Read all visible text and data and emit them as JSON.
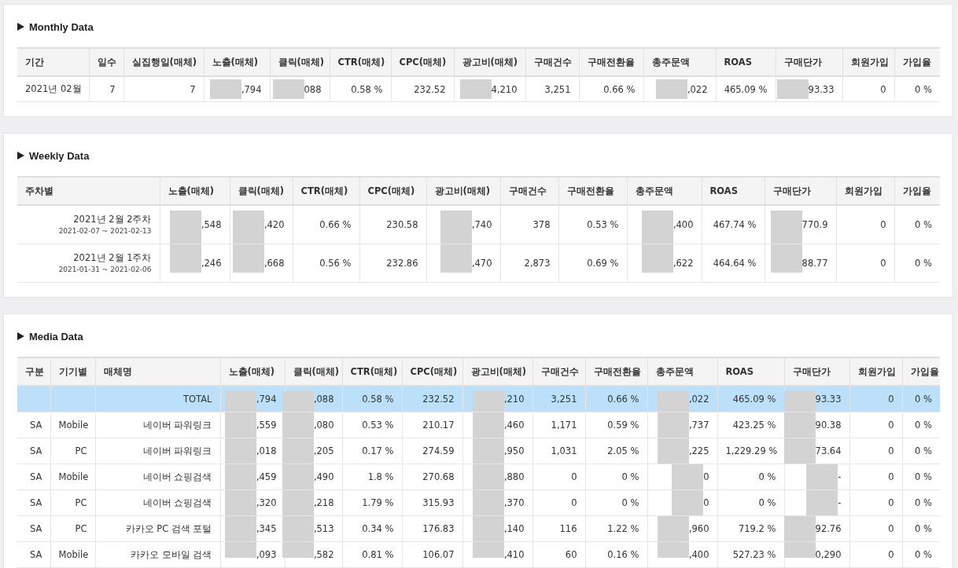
{
  "sections": [
    {
      "kind": "monthly",
      "title": "Monthly Data",
      "columns": [
        {
          "label": "기간",
          "redacted": false
        },
        {
          "label": "일수",
          "redacted": false
        },
        {
          "label": "실집행일(매체)",
          "redacted": false
        },
        {
          "label": "노출(매체)",
          "redacted": true
        },
        {
          "label": "클릭(매체)",
          "redacted": true
        },
        {
          "label": "CTR(매체)",
          "redacted": false
        },
        {
          "label": "CPC(매체)",
          "redacted": false
        },
        {
          "label": "광고비(매체)",
          "redacted": true
        },
        {
          "label": "구매건수",
          "redacted": false
        },
        {
          "label": "구매전환율",
          "redacted": false
        },
        {
          "label": "총주문액",
          "redacted": true
        },
        {
          "label": "ROAS",
          "redacted": false
        },
        {
          "label": "구매단가",
          "redacted": true
        },
        {
          "label": "회원가입",
          "redacted": false
        },
        {
          "label": "가입율",
          "redacted": false
        }
      ],
      "rows": [
        {
          "cells": [
            "2021년 02월",
            "7",
            "7",
            ",794",
            "088",
            "0.58 %",
            "232.52",
            "4,210",
            "3,251",
            "0.66 %",
            ",022",
            "465.09 %",
            "93.33",
            "0",
            "0 %"
          ]
        }
      ]
    },
    {
      "kind": "weekly",
      "title": "Weekly Data",
      "columns": [
        {
          "label": "주차별",
          "redacted": false
        },
        {
          "label": "노출(매체)",
          "redacted": true
        },
        {
          "label": "클릭(매체)",
          "redacted": true
        },
        {
          "label": "CTR(매체)",
          "redacted": false
        },
        {
          "label": "CPC(매체)",
          "redacted": false
        },
        {
          "label": "광고비(매체)",
          "redacted": true
        },
        {
          "label": "구매건수",
          "redacted": false
        },
        {
          "label": "구매전환율",
          "redacted": false
        },
        {
          "label": "총주문액",
          "redacted": true
        },
        {
          "label": "ROAS",
          "redacted": false
        },
        {
          "label": "구매단가",
          "redacted": true
        },
        {
          "label": "회원가입",
          "redacted": false
        },
        {
          "label": "가입율",
          "redacted": false
        }
      ],
      "rows": [
        {
          "cells": [
            {
              "label": "2021년 2월 2주차",
              "range": "2021-02-07 ~ 2021-02-13"
            },
            ",548",
            ",420",
            "0.66 %",
            "230.58",
            ",740",
            "378",
            "0.53 %",
            ",400",
            "467.74 %",
            "770.9",
            "0",
            "0 %"
          ]
        },
        {
          "cells": [
            {
              "label": "2021년 2월 1주차",
              "range": "2021-01-31 ~ 2021-02-06"
            },
            ",246",
            ",668",
            "0.56 %",
            "232.86",
            ",470",
            "2,873",
            "0.69 %",
            ",622",
            "464.64 %",
            "88.77",
            "0",
            "0 %"
          ]
        }
      ]
    },
    {
      "kind": "media",
      "title": "Media Data",
      "columns": [
        {
          "label": "구분",
          "redacted": false
        },
        {
          "label": "기기별",
          "redacted": false
        },
        {
          "label": "매체명",
          "redacted": false
        },
        {
          "label": "노출(매체)",
          "redacted": true
        },
        {
          "label": "클릭(매체)",
          "redacted": true
        },
        {
          "label": "CTR(매체)",
          "redacted": false
        },
        {
          "label": "CPC(매체)",
          "redacted": false
        },
        {
          "label": "광고비(매체)",
          "redacted": true
        },
        {
          "label": "구매건수",
          "redacted": false
        },
        {
          "label": "구매전환율",
          "redacted": false
        },
        {
          "label": "총주문액",
          "redacted": true
        },
        {
          "label": "ROAS",
          "redacted": false
        },
        {
          "label": "구매단가",
          "redacted": true
        },
        {
          "label": "회원가입",
          "redacted": false
        },
        {
          "label": "가입율",
          "redacted": false
        }
      ],
      "rows": [
        {
          "selected": true,
          "cells": [
            null,
            null,
            "TOTAL",
            ",794",
            ",088",
            "0.58 %",
            "232.52",
            ",210",
            "3,251",
            "0.66 %",
            ",022",
            "465.09 %",
            "93.33",
            "0",
            "0 %"
          ]
        },
        {
          "selected": false,
          "cells": [
            "SA",
            "Mobile",
            "네이버 파워링크",
            ",559",
            ",080",
            "0.53 %",
            "210.17",
            ",460",
            "1,171",
            "0.59 %",
            ",737",
            "423.25 %",
            "90.38",
            "0",
            "0 %"
          ]
        },
        {
          "selected": false,
          "cells": [
            "SA",
            "PC",
            "네이버 파워링크",
            ",018",
            ",205",
            "0.17 %",
            "274.59",
            ",950",
            "1,031",
            "2.05 %",
            ",225",
            "1,229.29 %",
            "73.64",
            "0",
            "0 %"
          ]
        },
        {
          "selected": false,
          "cells": [
            "SA",
            "Mobile",
            "네이버 쇼핑검색",
            ",459",
            ",490",
            "1.8 %",
            "270.68",
            ",880",
            "0",
            "0 %",
            "0",
            "0 %",
            "-",
            "0",
            "0 %"
          ]
        },
        {
          "selected": false,
          "cells": [
            "SA",
            "PC",
            "네이버 쇼핑검색",
            ",320",
            ",218",
            "1.79 %",
            "315.93",
            ",370",
            "0",
            "0 %",
            "0",
            "0 %",
            "-",
            "0",
            "0 %"
          ]
        },
        {
          "selected": false,
          "cells": [
            "SA",
            "PC",
            "카카오 PC 검색 포털",
            ",345",
            ",513",
            "0.34 %",
            "176.83",
            ",140",
            "116",
            "1.22 %",
            ",960",
            "719.2 %",
            "92.76",
            "0",
            "0 %"
          ]
        },
        {
          "selected": false,
          "cells": [
            "SA",
            "Mobile",
            "카카오 모바일 검색",
            ",093",
            ",582",
            "0.81 %",
            "106.07",
            ",410",
            "60",
            "0.16 %",
            ",400",
            "527.23 %",
            "0,290",
            "0",
            "0 %"
          ]
        }
      ]
    }
  ]
}
